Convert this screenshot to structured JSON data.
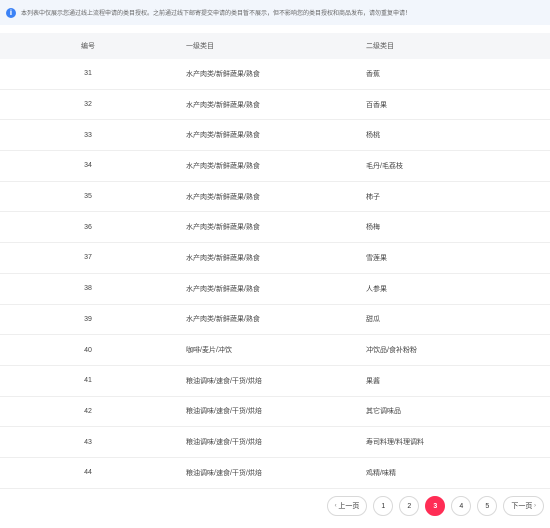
{
  "notice": {
    "icon": "info-icon",
    "text": "本列表中仅展示您通过线上流程申请的类目授权。之前通过线下邮寄提交申请的类目暂不展示，但不影响您的类目授权和商品发布，请勿重复申请！"
  },
  "table": {
    "headers": [
      "编号",
      "一级类目",
      "二级类目"
    ],
    "rows": [
      [
        "31",
        "水产肉类/新鲜蔬果/熟食",
        "香蕉"
      ],
      [
        "32",
        "水产肉类/新鲜蔬果/熟食",
        "百香果"
      ],
      [
        "33",
        "水产肉类/新鲜蔬果/熟食",
        "杨桃"
      ],
      [
        "34",
        "水产肉类/新鲜蔬果/熟食",
        "毛丹/毛荔枝"
      ],
      [
        "35",
        "水产肉类/新鲜蔬果/熟食",
        "柿子"
      ],
      [
        "36",
        "水产肉类/新鲜蔬果/熟食",
        "杨梅"
      ],
      [
        "37",
        "水产肉类/新鲜蔬果/熟食",
        "雪莲果"
      ],
      [
        "38",
        "水产肉类/新鲜蔬果/熟食",
        "人参果"
      ],
      [
        "39",
        "水产肉类/新鲜蔬果/熟食",
        "甜瓜"
      ],
      [
        "40",
        "咖啡/麦片/冲饮",
        "冲饮品/食补粉粉"
      ],
      [
        "41",
        "粮油调味/速食/干货/烘焙",
        "果酱"
      ],
      [
        "42",
        "粮油调味/速食/干货/烘焙",
        "其它调味品"
      ],
      [
        "43",
        "粮油调味/速食/干货/烘焙",
        "寿司料理/料理调料"
      ],
      [
        "44",
        "粮油调味/速食/干货/烘焙",
        "鸡精/味精"
      ]
    ]
  },
  "pagination": {
    "prev_label": "上一页",
    "next_label": "下一页",
    "pages": [
      "1",
      "2",
      "3",
      "4",
      "5"
    ],
    "current": "3",
    "accent_color": "#ff2d55"
  }
}
